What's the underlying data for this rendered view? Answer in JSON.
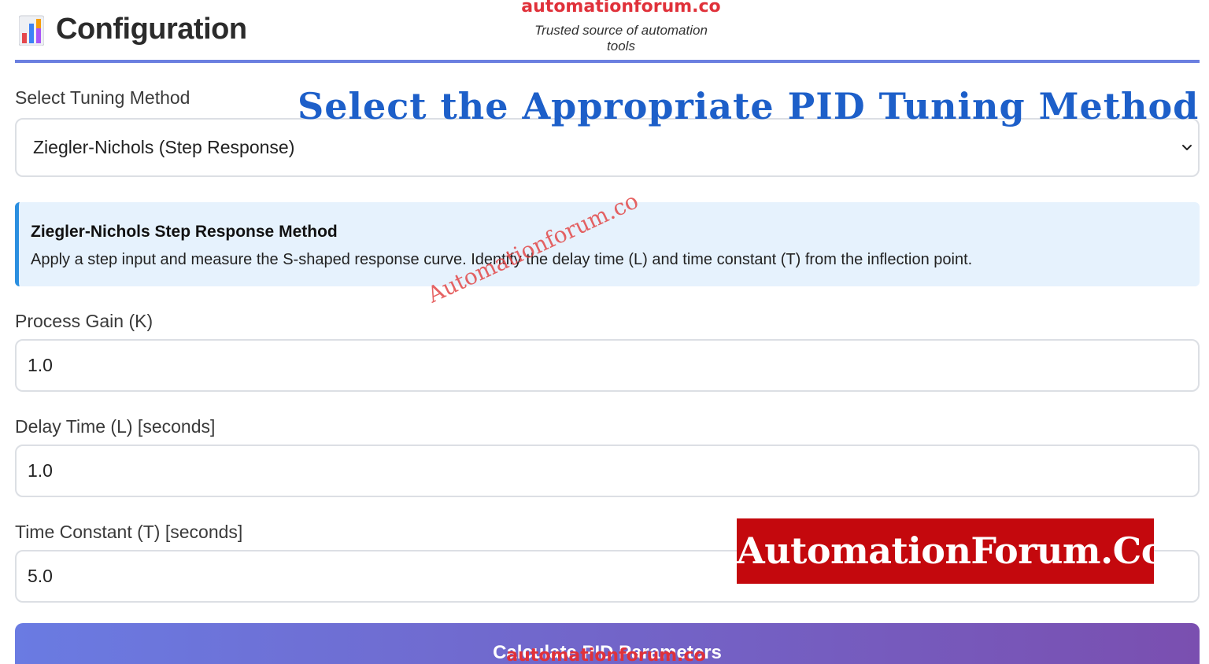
{
  "header": {
    "title": "Configuration",
    "icon": "bar-chart-icon",
    "brand_watermark": "automationforum.co",
    "brand_tagline": "Trusted source of automation tools"
  },
  "overlay_heading": "Select the Appropriate PID Tuning Method",
  "tuning_method": {
    "label": "Select Tuning Method",
    "selected": "Ziegler-Nichols (Step Response)"
  },
  "info": {
    "title": "Ziegler-Nichols Step Response Method",
    "description": "Apply a step input and measure the S-shaped response curve. Identify the delay time (L) and time constant (T) from the inflection point."
  },
  "fields": {
    "process_gain": {
      "label": "Process Gain (K)",
      "value": "1.0"
    },
    "delay_time": {
      "label": "Delay Time (L) [seconds]",
      "value": "1.0"
    },
    "time_constant": {
      "label": "Time Constant (T) [seconds]",
      "value": "5.0"
    }
  },
  "button": {
    "label": "Calculate PID Parameters"
  },
  "watermarks": {
    "diagonal": "Automationforum.co",
    "badge": "AutomationForum.Co",
    "button_overlay": "automationforum.co"
  },
  "colors": {
    "accent": "#6b7fe0",
    "heading_blue": "#1d5fc9",
    "info_bg": "#e6f2fd",
    "info_border": "#2b8fe0",
    "button_start": "#6a7be2",
    "button_end": "#7a4fb0",
    "watermark_red": "#c4080d"
  }
}
